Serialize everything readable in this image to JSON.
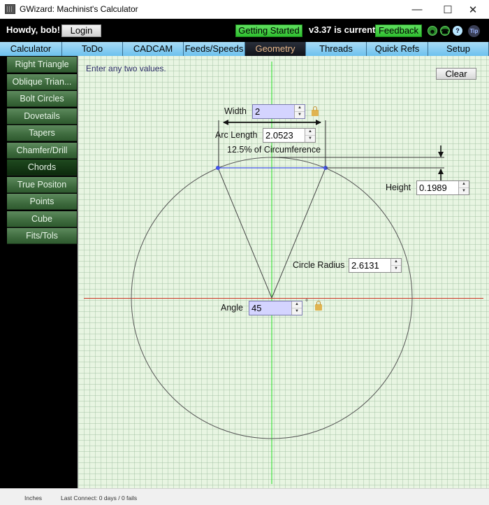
{
  "window": {
    "title": "GWizard: Machinist's Calculator",
    "controls": {
      "minimize": "—",
      "maximize": "☐",
      "close": "✕"
    }
  },
  "header": {
    "greeting": "Howdy, bob!",
    "login_label": "Login",
    "getting_started_label": "Getting Started",
    "version_text": "v3.37 is current",
    "feedback_label": "Feedback",
    "icons": [
      {
        "name": "community-icon",
        "glyph": "☻"
      },
      {
        "name": "support-icon",
        "glyph": "☎"
      },
      {
        "name": "help-icon",
        "glyph": "?"
      },
      {
        "name": "tip-icon",
        "glyph": "Tip"
      }
    ]
  },
  "tabs": [
    {
      "label": "Calculator",
      "active": false
    },
    {
      "label": "ToDo",
      "active": false
    },
    {
      "label": "CADCAM",
      "active": false
    },
    {
      "label": "Feeds/Speeds",
      "active": false
    },
    {
      "label": "Geometry",
      "active": true
    },
    {
      "label": "Threads",
      "active": false
    },
    {
      "label": "Quick Refs",
      "active": false
    },
    {
      "label": "Setup",
      "active": false
    }
  ],
  "sidebar": {
    "items": [
      {
        "label": "Right Triangle",
        "active": false
      },
      {
        "label": "Oblique Trian...",
        "active": false
      },
      {
        "label": "Bolt Circles",
        "active": false
      },
      {
        "label": "Dovetails",
        "active": false
      },
      {
        "label": "Tapers",
        "active": false
      },
      {
        "label": "Chamfer/Drill",
        "active": false
      },
      {
        "label": "Chords",
        "active": true
      },
      {
        "label": "True Positon",
        "active": false
      },
      {
        "label": "Points",
        "active": false
      },
      {
        "label": "Cube",
        "active": false
      },
      {
        "label": "Fits/Tols",
        "active": false
      }
    ]
  },
  "chords": {
    "hint": "Enter any two values.",
    "clear_label": "Clear",
    "width": {
      "label": "Width",
      "value": "2",
      "locked": true
    },
    "arc_length": {
      "label": "Arc Length",
      "value": "2.0523"
    },
    "circumference_note": "12.5% of Circumference",
    "height": {
      "label": "Height",
      "value": "0.1989"
    },
    "circle_radius": {
      "label": "Circle Radius",
      "value": "2.6131"
    },
    "angle": {
      "label": "Angle",
      "value": "45",
      "unit": "°",
      "locked": true
    }
  },
  "colors": {
    "tab_bg": "#6cc1ee",
    "active_tab_text": "#e9b88a",
    "sidebar_green": "#3e6b3e",
    "green_button": "#2fbf2f",
    "canvas_bg": "#e8f5e2",
    "chord_line": "#4455ee",
    "x_axis": "#cc3322",
    "y_axis": "#22dd22"
  },
  "statusbar": {
    "units": "Inches",
    "last_connect": "Last Connect: 0 days / 0 fails"
  }
}
